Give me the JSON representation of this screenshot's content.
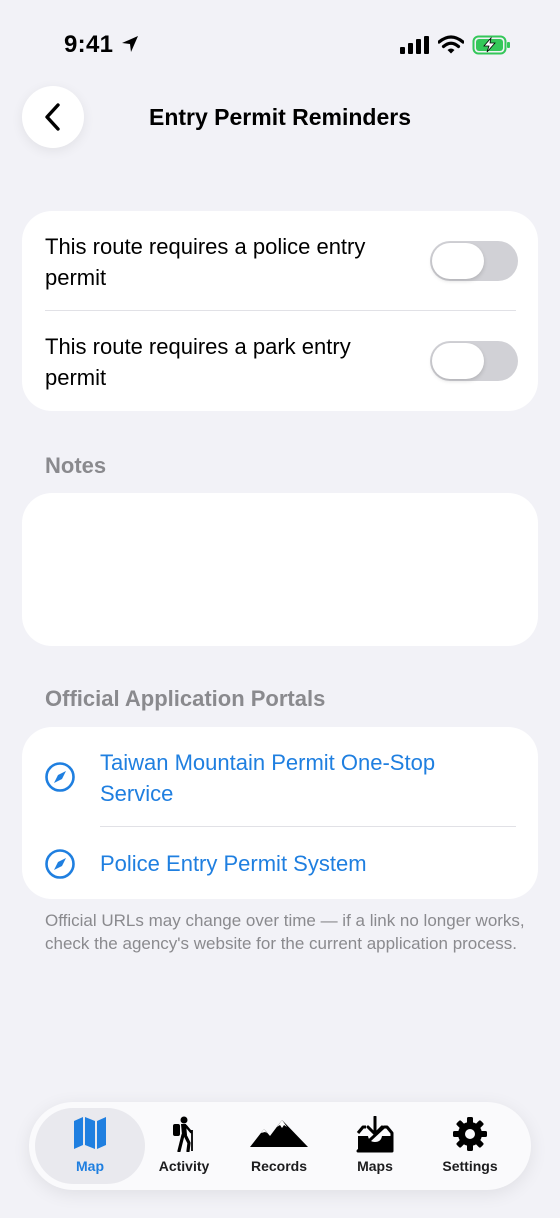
{
  "status_bar": {
    "time": "9:41"
  },
  "nav": {
    "title": "Entry Permit Reminders"
  },
  "toggles": [
    {
      "label": "This route requires a police entry permit",
      "on": false
    },
    {
      "label": "This route requires a park entry permit",
      "on": false
    }
  ],
  "notes": {
    "header": "Notes",
    "value": ""
  },
  "portals": {
    "header": "Official Application Portals",
    "links": [
      {
        "label": "Taiwan Mountain Permit One-Stop Service",
        "icon": "compass-icon"
      },
      {
        "label": "Police Entry Permit System",
        "icon": "compass-icon"
      }
    ]
  },
  "footnote": "Official URLs may change over time — if a link no longer works, check the agency's website for the current application process.",
  "tabs": [
    {
      "label": "Map",
      "icon": "map-icon",
      "active": true
    },
    {
      "label": "Activity",
      "icon": "hiker-icon",
      "active": false
    },
    {
      "label": "Records",
      "icon": "mountains-icon",
      "active": false
    },
    {
      "label": "Maps",
      "icon": "tray-download-icon",
      "active": false
    },
    {
      "label": "Settings",
      "icon": "gear-icon",
      "active": false
    }
  ],
  "colors": {
    "accent": "#1f7fe0",
    "background": "#f2f2f7",
    "toggle_off": "#d1d1d6",
    "battery": "#34c759"
  }
}
